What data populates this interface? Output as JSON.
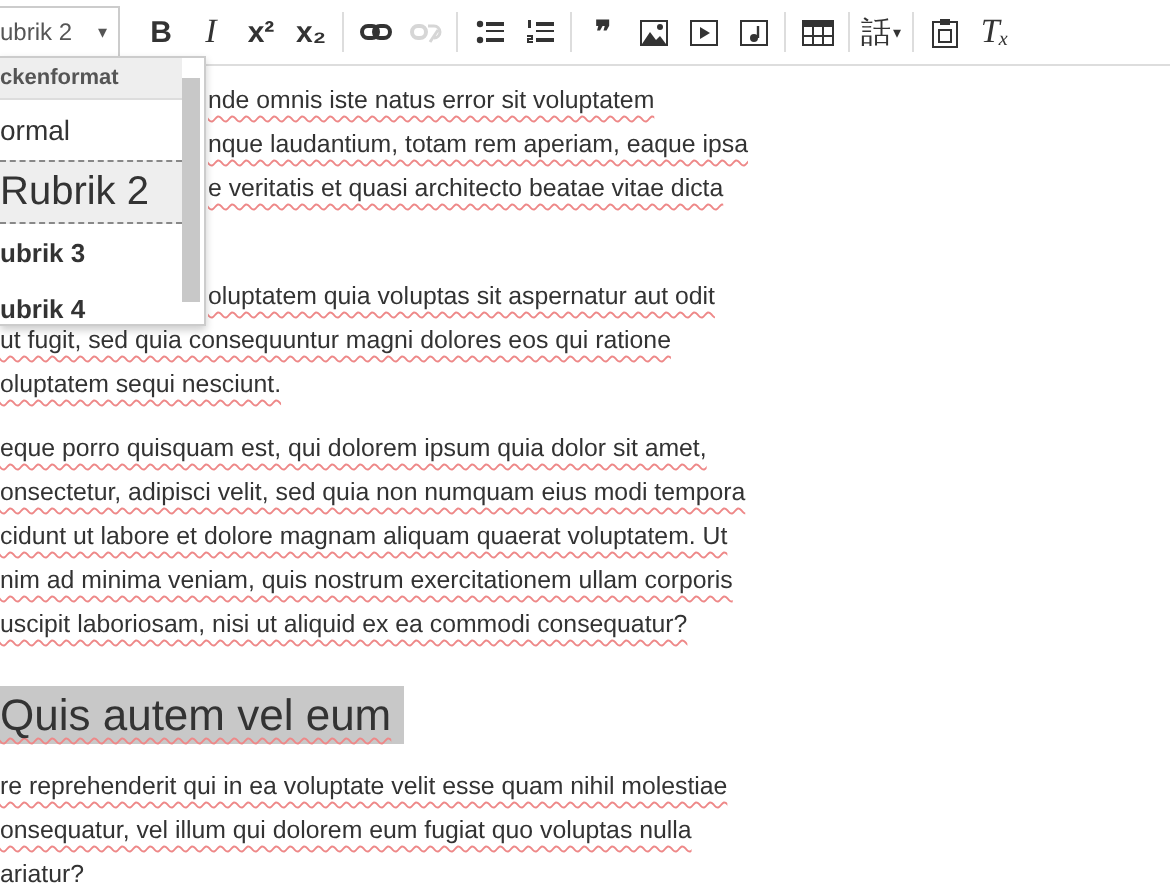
{
  "toolbar": {
    "format_combo": {
      "value": "ubrik 2",
      "caret": "▾"
    },
    "items": [
      {
        "kind": "text",
        "label": "B",
        "disabled": false
      },
      {
        "kind": "text",
        "label": "I",
        "disabled": false
      },
      {
        "kind": "text",
        "label": "x²",
        "disabled": false
      },
      {
        "kind": "text",
        "label": "x₂",
        "disabled": false
      },
      {
        "kind": "separator"
      },
      {
        "kind": "icon",
        "disabled": false
      },
      {
        "kind": "icon",
        "disabled": true
      },
      {
        "kind": "separator"
      },
      {
        "kind": "icon",
        "disabled": false
      },
      {
        "kind": "icon",
        "disabled": false
      },
      {
        "kind": "separator"
      },
      {
        "kind": "text",
        "label": "❞",
        "disabled": false
      },
      {
        "kind": "icon",
        "disabled": false
      },
      {
        "kind": "icon",
        "disabled": false
      },
      {
        "kind": "icon",
        "disabled": false
      },
      {
        "kind": "separator"
      },
      {
        "kind": "icon",
        "disabled": false
      },
      {
        "kind": "separator"
      },
      {
        "kind": "text",
        "label": "話",
        "caret": "▾",
        "disabled": false
      },
      {
        "kind": "separator"
      },
      {
        "kind": "icon",
        "disabled": false
      },
      {
        "kind": "text",
        "label": "Tₓ",
        "disabled": false
      }
    ]
  },
  "format_menu": {
    "header": "ckenformat",
    "items": [
      {
        "label": "ormal",
        "kind": "normal",
        "selected": false
      },
      {
        "label": "Rubrik 2",
        "kind": "h2",
        "selected": true
      },
      {
        "label": "ubrik 3",
        "kind": "h3",
        "selected": false
      },
      {
        "label": "ubrik 4",
        "kind": "h4",
        "selected": false
      }
    ]
  },
  "document": [
    {
      "kind": "paragraph",
      "lines": [
        {
          "text": "nde omnis iste natus error sit voluptatem",
          "behind_menu": true
        },
        {
          "text": "nque laudantium, totam rem aperiam, eaque ipsa",
          "behind_menu": true
        },
        {
          "text": "e veritatis et quasi architecto beatae vitae dicta",
          "behind_menu": true
        }
      ]
    },
    {
      "kind": "paragraph",
      "lines": [
        {
          "text": "oluptatem quia voluptas sit aspernatur aut odit",
          "behind_menu": true
        },
        {
          "text": "ut fugit, sed quia consequuntur magni dolores eos qui ratione",
          "behind_menu": false
        },
        {
          "text": "oluptatem sequi nesciunt.",
          "behind_menu": false
        }
      ]
    },
    {
      "kind": "paragraph",
      "lines": [
        {
          "text": "eque porro quisquam est, qui dolorem ipsum quia dolor sit amet,",
          "behind_menu": false
        },
        {
          "text": "onsectetur, adipisci velit, sed quia non numquam eius modi tempora",
          "behind_menu": false
        },
        {
          "text": "cidunt ut labore et dolore magnam aliquam quaerat voluptatem. Ut",
          "behind_menu": false
        },
        {
          "text": "nim ad minima veniam, quis nostrum exercitationem ullam corporis",
          "behind_menu": false
        },
        {
          "text": "uscipit laboriosam, nisi ut aliquid ex ea commodi consequatur?",
          "behind_menu": false
        }
      ]
    },
    {
      "kind": "heading",
      "selected": true,
      "lines": [
        {
          "text": "Quis autem vel eum",
          "behind_menu": false
        }
      ]
    },
    {
      "kind": "paragraph",
      "lines": [
        {
          "text": "re reprehenderit qui in ea voluptate velit esse quam nihil molestiae",
          "behind_menu": false
        },
        {
          "text": "onsequatur, vel illum qui dolorem eum fugiat quo voluptas nulla",
          "behind_menu": false
        },
        {
          "text": "ariatur?",
          "behind_menu": false
        }
      ]
    }
  ]
}
